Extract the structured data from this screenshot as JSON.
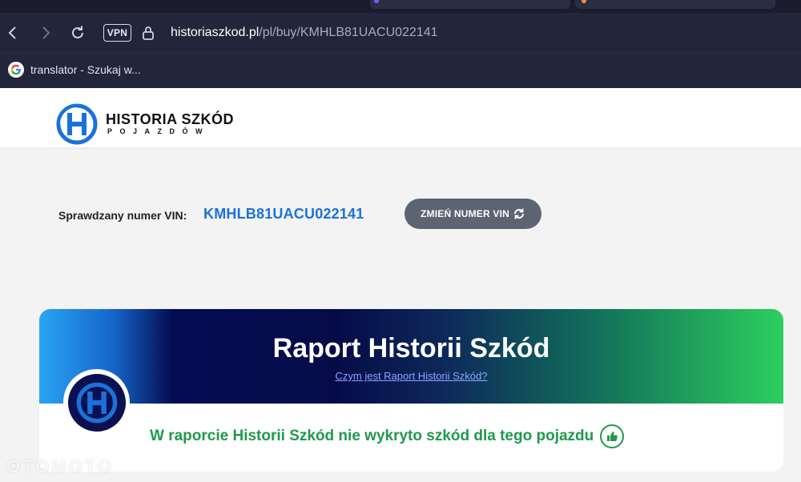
{
  "browser": {
    "url_host": "historiaszkod.pl",
    "url_path": "/pl/buy/KMHLB81UACU022141",
    "vpn_label": "VPN",
    "bookmark_label": "translator - Szukaj w...",
    "icons": {
      "back": "back-arrow-icon",
      "forward": "forward-arrow-icon",
      "reload": "reload-icon",
      "lock": "lock-icon",
      "bookmark": "google-icon"
    }
  },
  "header": {
    "logo_title": "HISTORIA SZKÓD",
    "logo_subtitle": "POJAZDÓW"
  },
  "vin": {
    "label": "Sprawdzany numer VIN:",
    "value": "KMHLB81UACU022141",
    "change_button": "ZMIEŃ NUMER VIN"
  },
  "report": {
    "title": "Raport Historii Szkód",
    "link": "Czym jest Raport Historii Szkód?",
    "result": "W raporcie Historii Szkód nie wykryto szkód dla tego pojazdu"
  },
  "watermark": "OTOMOTO",
  "colors": {
    "vin_blue": "#1a72d9",
    "success_green": "#1f9a4a",
    "button_gray": "#5b6470"
  }
}
